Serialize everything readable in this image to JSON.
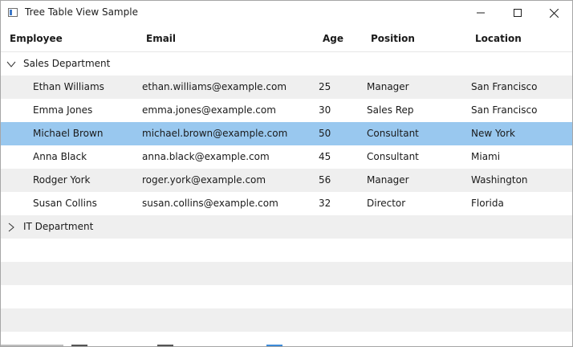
{
  "window": {
    "title": "Tree Table View Sample",
    "controls": {
      "minimize": "minimize-icon",
      "maximize": "maximize-icon",
      "close": "close-icon"
    }
  },
  "table": {
    "columns": [
      {
        "label": "Employee"
      },
      {
        "label": "Email"
      },
      {
        "label": "Age"
      },
      {
        "label": "Position"
      },
      {
        "label": "Location"
      }
    ],
    "groups": [
      {
        "name": "Sales Department",
        "expanded": true,
        "rows": [
          {
            "employee": "Ethan Williams",
            "email": "ethan.williams@example.com",
            "age": "25",
            "position": "Manager",
            "location": "San Francisco"
          },
          {
            "employee": "Emma Jones",
            "email": "emma.jones@example.com",
            "age": "30",
            "position": "Sales Rep",
            "location": "San Francisco"
          },
          {
            "employee": "Michael Brown",
            "email": "michael.brown@example.com",
            "age": "50",
            "position": "Consultant",
            "location": "New York",
            "selected": true
          },
          {
            "employee": "Anna Black",
            "email": "anna.black@example.com",
            "age": "45",
            "position": "Consultant",
            "location": "Miami"
          },
          {
            "employee": "Rodger York",
            "email": "roger.york@example.com",
            "age": "56",
            "position": "Manager",
            "location": "Washington"
          },
          {
            "employee": "Susan Collins",
            "email": "susan.collins@example.com",
            "age": "32",
            "position": "Director",
            "location": "Florida"
          }
        ]
      },
      {
        "name": "IT Department",
        "expanded": false,
        "rows": []
      }
    ]
  },
  "colors": {
    "selected_row": "#99c8ef",
    "alt_row": "#efefef"
  }
}
